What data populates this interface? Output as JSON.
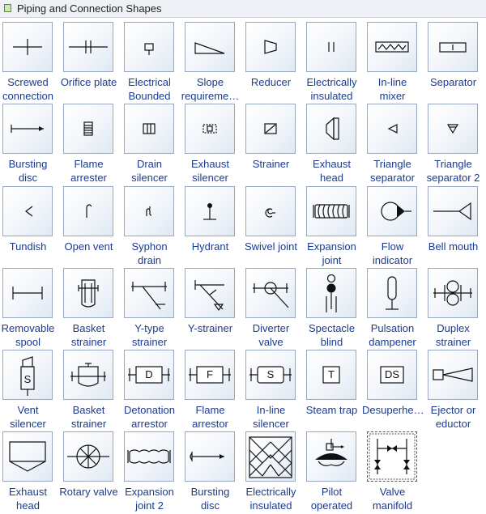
{
  "panel": {
    "title": "Piping and Connection Shapes"
  },
  "shapes": [
    {
      "l1": "Screwed",
      "l2": "connection",
      "icon": "screwed-connection-icon"
    },
    {
      "l1": "Orifice plate",
      "l2": "",
      "icon": "orifice-plate-icon"
    },
    {
      "l1": "Electrical",
      "l2": "Bounded",
      "icon": "electrical-bounded-icon"
    },
    {
      "l1": "Slope",
      "l2": "requireme…",
      "icon": "slope-requirement-icon"
    },
    {
      "l1": "Reducer",
      "l2": "",
      "icon": "reducer-icon"
    },
    {
      "l1": "Electrically",
      "l2": "insulated",
      "icon": "electrically-insulated-icon"
    },
    {
      "l1": "In-line",
      "l2": "mixer",
      "icon": "inline-mixer-icon"
    },
    {
      "l1": "Separator",
      "l2": "",
      "icon": "separator-icon"
    },
    {
      "l1": "Bursting",
      "l2": "disc",
      "icon": "bursting-disc-icon"
    },
    {
      "l1": "Flame",
      "l2": "arrester",
      "icon": "flame-arrester-icon"
    },
    {
      "l1": "Drain",
      "l2": "silencer",
      "icon": "drain-silencer-icon"
    },
    {
      "l1": "Exhaust",
      "l2": "silencer",
      "icon": "exhaust-silencer-icon"
    },
    {
      "l1": "Strainer",
      "l2": "",
      "icon": "strainer-icon"
    },
    {
      "l1": "Exhaust",
      "l2": "head",
      "icon": "exhaust-head-icon"
    },
    {
      "l1": "Triangle",
      "l2": "separator",
      "icon": "triangle-separator-icon"
    },
    {
      "l1": "Triangle",
      "l2": "separator 2",
      "icon": "triangle-separator-2-icon"
    },
    {
      "l1": "Tundish",
      "l2": "",
      "icon": "tundish-icon"
    },
    {
      "l1": "Open vent",
      "l2": "",
      "icon": "open-vent-icon"
    },
    {
      "l1": "Syphon",
      "l2": "drain",
      "icon": "syphon-drain-icon"
    },
    {
      "l1": "Hydrant",
      "l2": "",
      "icon": "hydrant-icon"
    },
    {
      "l1": "Swivel joint",
      "l2": "",
      "icon": "swivel-joint-icon"
    },
    {
      "l1": "Expansion",
      "l2": "joint",
      "icon": "expansion-joint-icon"
    },
    {
      "l1": "Flow",
      "l2": "indicator",
      "icon": "flow-indicator-icon"
    },
    {
      "l1": "Bell mouth",
      "l2": "",
      "icon": "bell-mouth-icon"
    },
    {
      "l1": "Removable",
      "l2": "spool",
      "icon": "removable-spool-icon"
    },
    {
      "l1": "Basket",
      "l2": "strainer",
      "icon": "basket-strainer-icon"
    },
    {
      "l1": "Y-type",
      "l2": "strainer",
      "icon": "y-type-strainer-icon"
    },
    {
      "l1": "Y-strainer",
      "l2": "",
      "icon": "y-strainer-icon"
    },
    {
      "l1": "Diverter",
      "l2": "valve",
      "icon": "diverter-valve-icon"
    },
    {
      "l1": "Spectacle",
      "l2": "blind",
      "icon": "spectacle-blind-icon"
    },
    {
      "l1": "Pulsation",
      "l2": "dampener",
      "icon": "pulsation-dampener-icon"
    },
    {
      "l1": "Duplex",
      "l2": "strainer",
      "icon": "duplex-strainer-icon"
    },
    {
      "l1": "Vent",
      "l2": "silencer",
      "icon": "vent-silencer-icon",
      "glyph": "S"
    },
    {
      "l1": "Basket",
      "l2": "strainer",
      "icon": "basket-strainer-2-icon"
    },
    {
      "l1": "Detonation",
      "l2": "arrestor",
      "icon": "detonation-arrestor-icon",
      "glyph": "D"
    },
    {
      "l1": "Flame",
      "l2": "arrestor",
      "icon": "flame-arrestor-icon",
      "glyph": "F"
    },
    {
      "l1": "In-line",
      "l2": "silencer",
      "icon": "inline-silencer-icon",
      "glyph": "S"
    },
    {
      "l1": "Steam trap",
      "l2": "",
      "icon": "steam-trap-icon",
      "glyph": "T"
    },
    {
      "l1": "Desuperhe…",
      "l2": "",
      "icon": "desuperheater-icon",
      "glyph": "DS"
    },
    {
      "l1": "Ejector or",
      "l2": "eductor",
      "icon": "ejector-eductor-icon"
    },
    {
      "l1": "Exhaust",
      "l2": "head",
      "icon": "exhaust-head-2-icon"
    },
    {
      "l1": "Rotary valve",
      "l2": "",
      "icon": "rotary-valve-icon"
    },
    {
      "l1": "Expansion",
      "l2": "joint 2",
      "icon": "expansion-joint-2-icon"
    },
    {
      "l1": "Bursting",
      "l2": "disc",
      "icon": "bursting-disc-2-icon"
    },
    {
      "l1": "Electrically",
      "l2": "insulated",
      "icon": "electrically-insulated-2-icon"
    },
    {
      "l1": "Pilot",
      "l2": "operated",
      "icon": "pilot-operated-icon"
    },
    {
      "l1": "Valve",
      "l2": "manifold",
      "icon": "valve-manifold-icon"
    }
  ]
}
